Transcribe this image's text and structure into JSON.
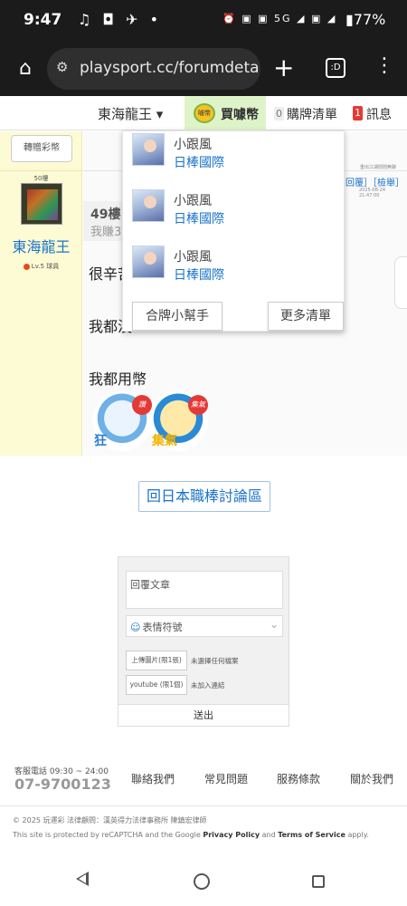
{
  "status": {
    "time": "9:47",
    "battery": "77%",
    "network": "5G"
  },
  "browser": {
    "url": "playsport.cc/forumdetai",
    "tab_count": ":D"
  },
  "nav": {
    "user": "東海龍王 ▾",
    "buy": "買噱幣",
    "coin_text": "噱幣",
    "cart_count": "0",
    "cart": "購牌清單",
    "msg_count": "1",
    "msg": "訊息"
  },
  "author": {
    "gift_button": "轉贈彩幣",
    "floor": "50樓",
    "name": "東海龍王",
    "level": "Lv.5 球員"
  },
  "post": {
    "meta1": "重出江湖閒閒無聊",
    "reply_link": "回覆］［檢舉］",
    "meta2": "2025-08-24 21:47:00",
    "quote_floor": "49樓",
    "quote_excerpt": "我賺3",
    "line1": "很辛苦",
    "line2": "我都沒",
    "line3": "我都用幣",
    "sticker1_text": "狂",
    "sticker1_badge": "讚",
    "sticker2_text": "集氣",
    "sticker2_badge": "集氣"
  },
  "dropdown": {
    "items": [
      {
        "name": "小跟風",
        "team": "日棒國際"
      },
      {
        "name": "小跟風",
        "team": "日棒國際"
      },
      {
        "name": "小跟風",
        "team": "日棒國際"
      }
    ],
    "helper_button": "合牌小幫手",
    "more_button": "更多清單"
  },
  "back_button": "回日本職棒討論區",
  "reply": {
    "placeholder": "回覆文章",
    "emoticon": "表情符號",
    "upload_image": "上傳圖片(限1張)",
    "upload_image_status": "未選擇任何檔案",
    "youtube": "youtube (限1個)",
    "youtube_status": "未加入連結",
    "send": "送出"
  },
  "footer": {
    "hours": "客服電話 09:30 ~ 24:00",
    "phone": "07-9700123",
    "links": [
      "聯絡我們",
      "常見問題",
      "服務條款",
      "關於我們"
    ],
    "copyright": "© 2025 玩運彩 法律顧問：漢英得力法律事務所 陳鎮宏律師",
    "captcha_pre": "This site is protected by reCAPTCHA and the Google ",
    "privacy": "Privacy Policy",
    "and": " and ",
    "terms": "Terms of Service",
    "apply": " apply."
  }
}
